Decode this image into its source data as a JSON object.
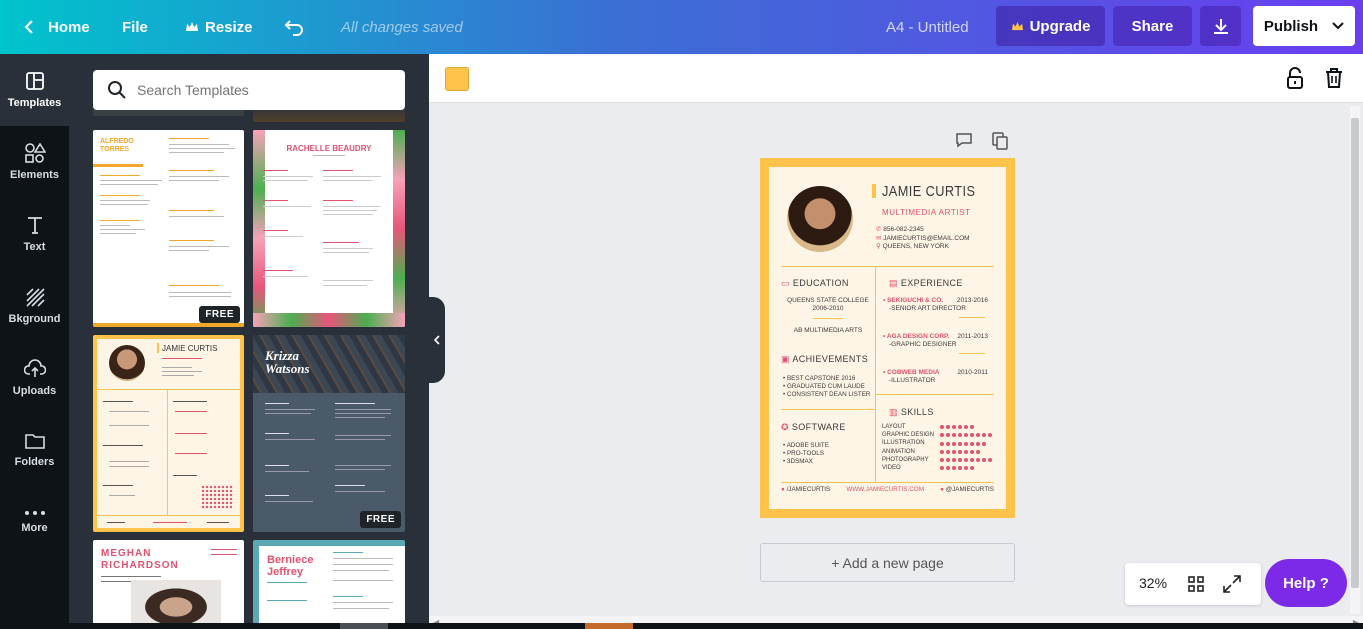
{
  "topbar": {
    "home": "Home",
    "file": "File",
    "resize": "Resize",
    "saved_status": "All changes saved",
    "doc_title": "A4 - Untitled",
    "upgrade": "Upgrade",
    "share": "Share",
    "publish": "Publish"
  },
  "rail": {
    "items": [
      {
        "label": "Templates",
        "icon": "template-icon"
      },
      {
        "label": "Elements",
        "icon": "shapes-icon"
      },
      {
        "label": "Text",
        "icon": "text-icon"
      },
      {
        "label": "Bkground",
        "icon": "background-icon"
      },
      {
        "label": "Uploads",
        "icon": "upload-icon"
      },
      {
        "label": "Folders",
        "icon": "folder-icon"
      },
      {
        "label": "More",
        "icon": "more-icon"
      }
    ]
  },
  "panel": {
    "search_placeholder": "Search Templates",
    "free_badge": "FREE",
    "templates": {
      "alfredo": {
        "name_line1": "ALFREDO",
        "name_line2": "TORRES"
      },
      "rachelle": {
        "name": "RACHELLE BEAUDRY"
      },
      "krizza": {
        "name_line1": "Krizza",
        "name_line2": "Watsons"
      },
      "meghan": {
        "name_line1": "MEGHAN",
        "name_line2": "RICHARDSON"
      },
      "berniece": {
        "name_line1": "Berniece",
        "name_line2": "Jeffrey"
      },
      "jamie_thumb": {
        "name": "JAMIE CURTIS"
      }
    }
  },
  "canvas": {
    "color_swatch": "#ffc24b",
    "add_page": "+ Add a new page",
    "zoom": "32%",
    "help": "Help ?"
  },
  "resume": {
    "name": "JAMIE CURTIS",
    "title": "MULTIMEDIA ARTIST",
    "phone": "856-082-2345",
    "email": "JAMIECURTIS@EMAIL.COM",
    "location": "QUEENS, NEW YORK",
    "education_heading": "EDUCATION",
    "education_school": "QUEENS STATE COLLEGE",
    "education_years": "2006-2010",
    "education_degree": "AB MULTIMEDIA ARTS",
    "achievements_heading": "ACHIEVEMENTS",
    "achievements": [
      "BEST CAPSTONE 2016",
      "GRADUATED CUM LAUDE",
      "CONSISTENT DEAN LISTER"
    ],
    "software_heading": "SOFTWARE",
    "software": [
      "ADOBE SUITE",
      "PRO-TOOLS",
      "3DSMAX"
    ],
    "experience_heading": "EXPERIENCE",
    "experience": [
      {
        "company": "SEKIGUCHI & CO.",
        "role": "-SENIOR ART DIRECTOR",
        "years": "2013-2016"
      },
      {
        "company": "AGA DESIGN CORP.",
        "role": "-GRAPHIC DESIGNER",
        "years": "2011-2013"
      },
      {
        "company": "COBWEB MEDIA",
        "role": "-ILLUSTRATOR",
        "years": "2010-2011"
      }
    ],
    "skills_heading": "SKILLS",
    "skills": [
      {
        "name": "LAYOUT",
        "level": 6
      },
      {
        "name": "GRAPHIC DESIGN",
        "level": 9
      },
      {
        "name": "ILLUSTRATION",
        "level": 8
      },
      {
        "name": "ANIMATION",
        "level": 7
      },
      {
        "name": "PHOTOGRAPHY",
        "level": 9
      },
      {
        "name": "VIDEO",
        "level": 6
      }
    ],
    "footer_left": "/JAMIECURTIS",
    "footer_mid": "WWW.JAMIECURTIS.COM",
    "footer_right": "@JAMIECURTIS",
    "colors": {
      "border": "#ffc24b",
      "paper": "#fff5e6",
      "accent": "#e05270",
      "text": "#3a3a3a"
    }
  }
}
